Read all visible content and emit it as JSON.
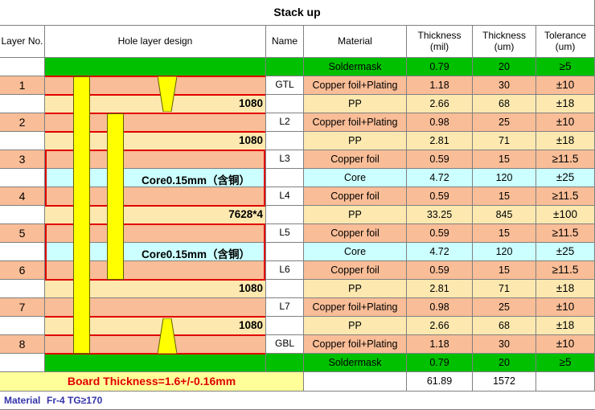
{
  "title": "Stack up",
  "headers": {
    "layer_no": "Layer No.",
    "hole_design": "Hole layer design",
    "name": "Name",
    "material": "Material",
    "thickness_mil": "Thickness\n(mil)",
    "thickness_um": "Thickness\n(um)",
    "tolerance": "Tolerance\n(um)"
  },
  "colors": {
    "green": "#00c000",
    "copper": "#f9bd97",
    "pp": "#fde9b0",
    "core": "#ccffff",
    "white": "#ffffff",
    "red": "#e00000",
    "via": "#ffff00",
    "footer": "#ffff99",
    "material_text": "#3333aa"
  },
  "rows": [
    {
      "type": "green",
      "layer_no": "",
      "name": "",
      "material": "Soldermask",
      "mil": "0.79",
      "um": "20",
      "tol": "≥5"
    },
    {
      "type": "copper",
      "layer_no": "1",
      "name": "GTL",
      "material": "Copper foil+Plating",
      "mil": "1.18",
      "um": "30",
      "tol": "±10"
    },
    {
      "type": "pp",
      "layer_no": "",
      "name": "",
      "material": "PP",
      "mil": "2.66",
      "um": "68",
      "tol": "±18",
      "design_label": "1080"
    },
    {
      "type": "copper",
      "layer_no": "2",
      "name": "L2",
      "material": "Copper foil+Plating",
      "mil": "0.98",
      "um": "25",
      "tol": "±10"
    },
    {
      "type": "pp",
      "layer_no": "",
      "name": "",
      "material": "PP",
      "mil": "2.81",
      "um": "71",
      "tol": "±18",
      "design_label": "1080"
    },
    {
      "type": "copper",
      "layer_no": "3",
      "name": "L3",
      "material": "Copper foil",
      "mil": "0.59",
      "um": "15",
      "tol": "≥11.5"
    },
    {
      "type": "core",
      "layer_no": "",
      "name": "",
      "material": "Core",
      "mil": "4.72",
      "um": "120",
      "tol": "±25",
      "design_label": "Core0.15mm（含铜）"
    },
    {
      "type": "copper",
      "layer_no": "4",
      "name": "L4",
      "material": "Copper foil",
      "mil": "0.59",
      "um": "15",
      "tol": "≥11.5"
    },
    {
      "type": "pp",
      "layer_no": "",
      "name": "",
      "material": "PP",
      "mil": "33.25",
      "um": "845",
      "tol": "±100",
      "design_label": "7628*4"
    },
    {
      "type": "copper",
      "layer_no": "5",
      "name": "L5",
      "material": "Copper foil",
      "mil": "0.59",
      "um": "15",
      "tol": "≥11.5"
    },
    {
      "type": "core",
      "layer_no": "",
      "name": "",
      "material": "Core",
      "mil": "4.72",
      "um": "120",
      "tol": "±25",
      "design_label": "Core0.15mm（含铜）"
    },
    {
      "type": "copper",
      "layer_no": "6",
      "name": "L6",
      "material": "Copper foil",
      "mil": "0.59",
      "um": "15",
      "tol": "≥11.5"
    },
    {
      "type": "pp",
      "layer_no": "",
      "name": "",
      "material": "PP",
      "mil": "2.81",
      "um": "71",
      "tol": "±18",
      "design_label": "1080"
    },
    {
      "type": "copper",
      "layer_no": "7",
      "name": "L7",
      "material": "Copper foil+Plating",
      "mil": "0.98",
      "um": "25",
      "tol": "±10"
    },
    {
      "type": "pp",
      "layer_no": "",
      "name": "",
      "material": "PP",
      "mil": "2.66",
      "um": "68",
      "tol": "±18",
      "design_label": "1080"
    },
    {
      "type": "copper",
      "layer_no": "8",
      "name": "GBL",
      "material": "Copper foil+Plating",
      "mil": "1.18",
      "um": "30",
      "tol": "±10"
    },
    {
      "type": "green",
      "layer_no": "",
      "name": "",
      "material": "Soldermask",
      "mil": "0.79",
      "um": "20",
      "tol": "≥5"
    }
  ],
  "footer": {
    "board_thickness": "Board Thickness=1.6+/-0.16mm",
    "total_mil": "61.89",
    "total_um": "1572",
    "material_label": "Material",
    "material_value": "Fr-4  TG≥170"
  }
}
